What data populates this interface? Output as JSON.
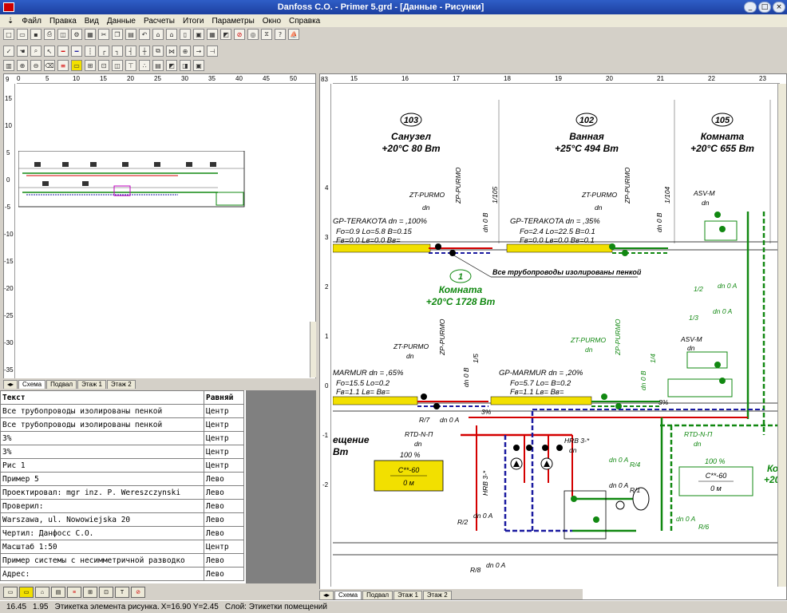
{
  "window": {
    "title": "Danfoss C.O. - Primer 5.grd - [Данные - Рисунки]"
  },
  "menu": [
    "Файл",
    "Правка",
    "Вид",
    "Данные",
    "Расчеты",
    "Итоги",
    "Параметры",
    "Окно",
    "Справка"
  ],
  "left_ruler": {
    "h_ticks": [
      "9",
      "0",
      "5",
      "10",
      "15",
      "20",
      "25",
      "30",
      "35",
      "40",
      "45",
      "50"
    ],
    "v_ticks": [
      "15",
      "10",
      "5",
      "0",
      "-5",
      "-10",
      "-15",
      "-20",
      "-25",
      "-30",
      "-35"
    ]
  },
  "right_ruler": {
    "corner": "83",
    "h_ticks": [
      "15",
      "16",
      "17",
      "18",
      "19",
      "20",
      "21",
      "22",
      "23"
    ],
    "v_ticks": [
      "4",
      "3",
      "2",
      "1",
      "0",
      "-1",
      "-2"
    ]
  },
  "sheet_tabs": [
    "Схема",
    "Подвал",
    "Этаж 1",
    "Этаж 2"
  ],
  "labels_table": {
    "headers": [
      "Текст",
      "Равняй"
    ],
    "rows": [
      [
        "Все трубопроводы изолированы пенкой",
        "Центр"
      ],
      [
        "Все трубопроводы изолированы пенкой",
        "Центр"
      ],
      [
        "3%",
        "Центр"
      ],
      [
        "3%",
        "Центр"
      ],
      [
        "Рис 1",
        "Центр"
      ],
      [
        "Пример 5",
        "Лево"
      ],
      [
        "Проектировал: mgr inz. P. Wereszczynski",
        "Лево"
      ],
      [
        "Проверил:",
        "Лево"
      ],
      [
        "Warszawa, ul. Nowowiejska 20",
        "Лево"
      ],
      [
        "Чертил: Данфосс С.О.",
        "Лево"
      ],
      [
        "Масштаб 1:50",
        "Центр"
      ],
      [
        "Пример системы с несимметричной разводко",
        "Лево"
      ],
      [
        "Адрес:",
        "Лево"
      ]
    ]
  },
  "drawing": {
    "rooms": [
      {
        "num": "103",
        "name": "Санузел",
        "temp": "+20°C 80 Вт"
      },
      {
        "num": "102",
        "name": "Ванная",
        "temp": "+25°C 494 Вт"
      },
      {
        "num": "105",
        "name": "Комната",
        "temp": "+20°C 655 Вт"
      },
      {
        "num": "1",
        "name": "Комната",
        "temp": "+20°C 1728 Вт"
      }
    ],
    "rad1": {
      "label": "GP-TERAKOTA dn = ,100%",
      "params": "Fo=0.9 Lo=5.8 B=0.15",
      "params2": "Fв=0.0 Lв=0.0 Bв="
    },
    "rad2": {
      "label": "GP-TERAKOTA dn = ,35%",
      "params": "Fo=2.4 Lo=22.5 B=0.1",
      "params2": "Fв=0.0 Lв=0.0 Bв=0.1"
    },
    "rad3": {
      "label": "MARMUR dn = ,65%",
      "params": "Fo=15.5 Lo=0.2",
      "params2": "Fв=1.1 Lв= Bв="
    },
    "rad4": {
      "label": "GP-MARMUR dn = ,20%",
      "params": "Fo=5.7 Lo= B=0.2",
      "params2": "Fв=1.1 Lв= Bв="
    },
    "note": "Все трубопроводы изолированы пенкой",
    "valves": [
      "ZT-PURMO",
      "ZP-PURMO",
      "ASV-M",
      "RTD-N-П",
      "HRB 3-*"
    ],
    "dn_labels": [
      "dn",
      "dn 0 B",
      "dn 0 A"
    ],
    "tags": [
      "1/105",
      "1/104",
      "1/5",
      "1/4",
      "1/2",
      "1/3",
      "R/7",
      "R/4",
      "R/1",
      "R/2",
      "R/6",
      "R/8"
    ],
    "box1": {
      "line1": "С**-60",
      "line2": "0 м"
    },
    "box2": {
      "line1": "С**-60",
      "line2": "0 м"
    },
    "pct": "100 %",
    "pct2": "3%",
    "side_text1": "ещение",
    "side_text2": "Вт",
    "side_text3": "Ко",
    "side_text4": "+20"
  },
  "status": {
    "x": "16.45",
    "y": "1.95",
    "text": "Этикетка элемента рисунка.",
    "coords": "X=16.90 Y=2.45",
    "layer": "Слой: Этикетки помещений"
  },
  "colors": {
    "supply": "#d40000",
    "return": "#1a1aa0",
    "green": "#118811",
    "radiator": "#f2e000",
    "titlebar": "#1c3f9f"
  }
}
